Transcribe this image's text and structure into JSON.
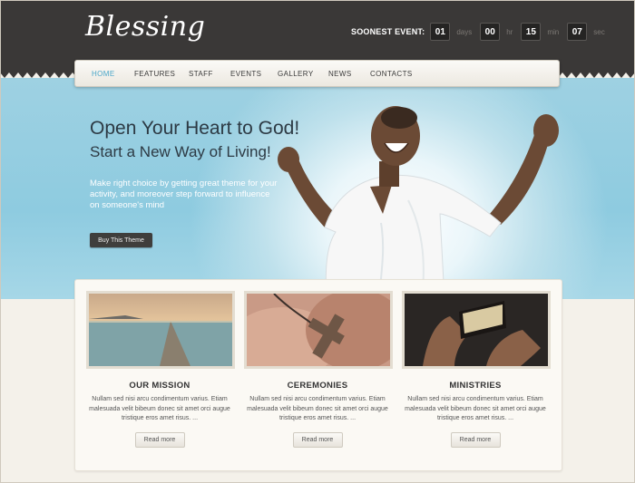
{
  "brand": {
    "logo": "Blessing"
  },
  "countdown": {
    "label": "SOONEST EVENT:",
    "units": [
      {
        "value": "01",
        "unit": "days"
      },
      {
        "value": "00",
        "unit": "hr"
      },
      {
        "value": "15",
        "unit": "min"
      },
      {
        "value": "07",
        "unit": "sec"
      }
    ]
  },
  "nav": {
    "items": [
      "HOME",
      "FEATURES",
      "STAFF",
      "EVENTS",
      "GALLERY",
      "NEWS",
      "CONTACTS"
    ],
    "active": "HOME"
  },
  "hero": {
    "title": "Open Your Heart to God!",
    "subtitle": "Start a New Way of Living!",
    "text": "Make right choice by getting great theme for your activity, and moreover step forward to influence on someone's mind",
    "button": "Buy This Theme"
  },
  "columns": [
    {
      "title": "OUR MISSION",
      "text": "Nullam sed nisi arcu condimentum varius. Etiam malesuada velit bibeum donec sit amet orci augue tristique eros amet risus. ...",
      "button": "Read more",
      "image": "pier-sunset-image"
    },
    {
      "title": "CEREMONIES",
      "text": "Nullam sed nisi arcu condimentum varius. Etiam malesuada velit bibeum donec sit amet orci augue tristique eros amet risus. ...",
      "button": "Read more",
      "image": "cross-in-hands-image"
    },
    {
      "title": "MINISTRIES",
      "text": "Nullam sed nisi arcu condimentum varius. Etiam malesuada velit bibeum donec sit amet orci augue tristique eros amet risus. ...",
      "button": "Read more",
      "image": "bible-reading-image"
    }
  ],
  "colors": {
    "header": "#3a3837",
    "accent": "#4aa6c9",
    "sky": "#8ecbe0"
  }
}
